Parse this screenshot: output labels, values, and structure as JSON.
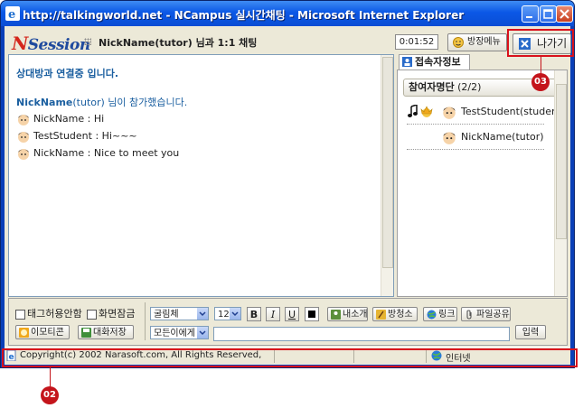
{
  "window": {
    "title": "http://talkingworld.net - NCampus 실시간채팅 - Microsoft Internet Explorer"
  },
  "header": {
    "logo_n": "N",
    "logo_rest": "Session",
    "room_title": "NickName(tutor) 님과 1:1 채팅",
    "timer": "0:01:52",
    "room_menu_label": "방장메뉴",
    "exit_label": "나가기"
  },
  "chat": {
    "connecting": "상대방과 연결중 입니다.",
    "joined_name": "NickName",
    "joined_rest": "(tutor) 님이 참가했습니다.",
    "messages": [
      {
        "text": "NickName : Hi"
      },
      {
        "text": "TestStudent : Hi~~~"
      },
      {
        "text": "NickName : Nice to meet you"
      }
    ]
  },
  "sidebar": {
    "tab_label": "접속자정보",
    "participants_label": "참여자명단",
    "participants_count": "(2/2)",
    "participants": [
      {
        "name": "TestStudent(student)"
      },
      {
        "name": "NickName(tutor)"
      }
    ]
  },
  "controls": {
    "tag_disable": "태그허용안함",
    "screen_lock": "화면잠금",
    "emoticon": "이모티콘",
    "save_chat": "대화저장",
    "font": "굴림체",
    "size": "12",
    "bold": "B",
    "italic": "I",
    "underline": "U",
    "intro": "내소개",
    "cleanup": "방청소",
    "link": "링크",
    "file_share": "파일공유",
    "recipient": "모든이에게",
    "input_value": "",
    "send": "입력"
  },
  "status": {
    "copyright": "Copyright(c) 2002 Narasoft.com,  All Rights Reserved,",
    "zone": "인터넷"
  },
  "callouts": {
    "exit_marker": "03",
    "window_marker": "02"
  },
  "colors": {
    "highlight": "#d9111c",
    "system_text": "#1b5fa0",
    "titlebar": "#0b58e6"
  }
}
